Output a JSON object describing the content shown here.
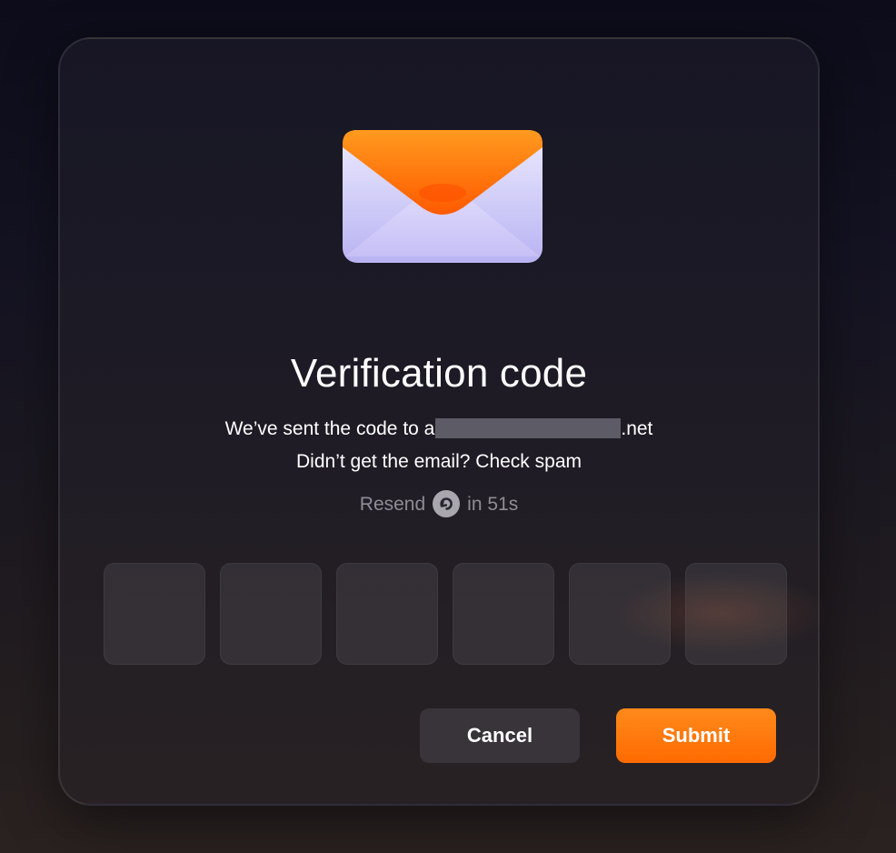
{
  "dialog": {
    "icon": "envelope-icon",
    "title": "Verification code",
    "sent_prefix": "We’ve sent the code to a",
    "sent_suffix": ".net",
    "spam_note": "Didn’t get the email? Check spam",
    "resend_label": "Resend",
    "resend_icon": "refresh-icon",
    "resend_countdown": "in 51s",
    "code_inputs": [
      "",
      "",
      "",
      "",
      "",
      ""
    ],
    "cancel_label": "Cancel",
    "submit_label": "Submit"
  },
  "colors": {
    "accent": "#ff7a00",
    "background": "#141322",
    "cancel_button": "#38343a",
    "muted_text": "#8e8c94"
  }
}
